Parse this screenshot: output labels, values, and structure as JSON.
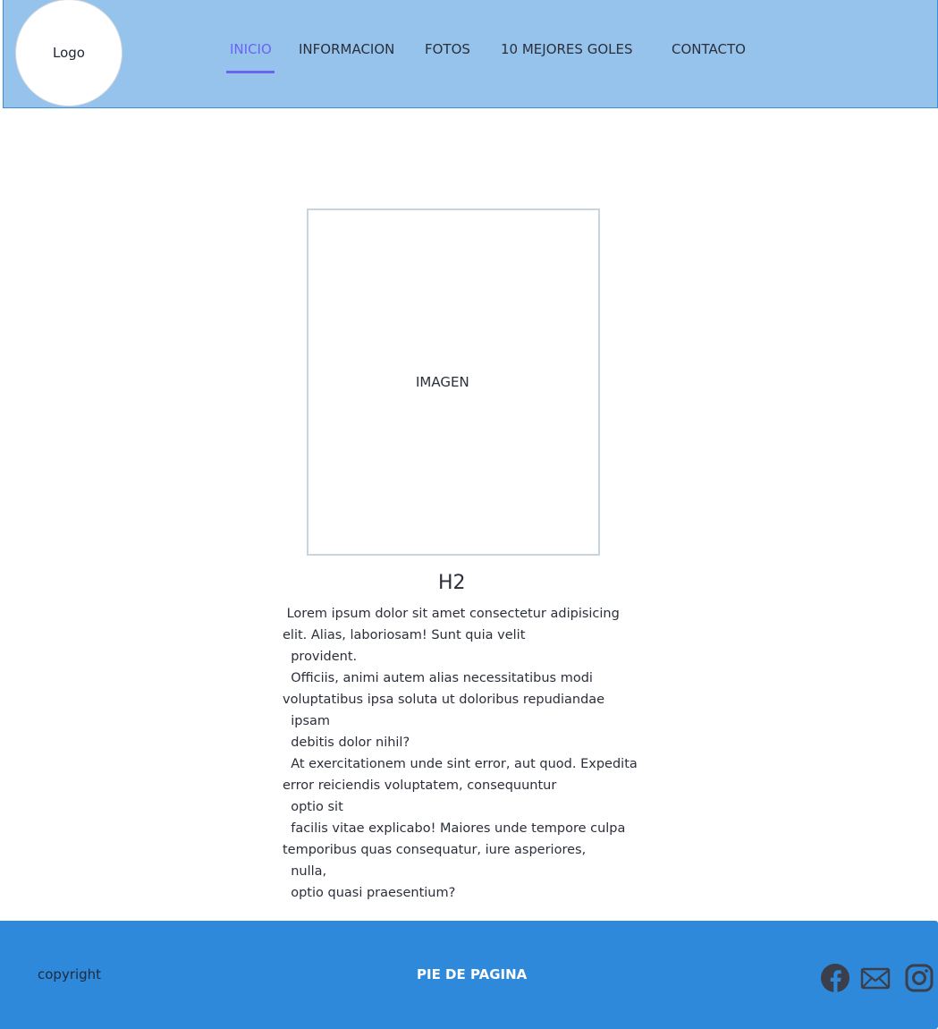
{
  "header": {
    "logo_label": "Logo",
    "nav": [
      {
        "label": "INICIO",
        "active": true
      },
      {
        "label": "INFORMACION",
        "active": false
      },
      {
        "label": "FOTOS",
        "active": false
      },
      {
        "label": "10 MEJORES GOLES",
        "active": false
      },
      {
        "label": "CONTACTO",
        "active": false
      }
    ]
  },
  "main": {
    "image_label": "IMAGEN",
    "heading": "H2",
    "paragraph_lines": [
      " Lorem ipsum dolor sit amet consectetur adipisicing",
      "elit. Alias, laboriosam! Sunt quia velit",
      "  provident.",
      "  Officiis, animi autem alias necessitatibus modi",
      "voluptatibus ipsa soluta ut doloribus repudiandae",
      "  ipsam",
      "  debitis dolor nihil?",
      "  At exercitationem unde sint error, aut quod. Expedita",
      "error reiciendis voluptatem, consequuntur",
      "  optio sit",
      "  facilis vitae explicabo! Maiores unde tempore culpa",
      "temporibus quas consequatur, iure asperiores,",
      "  nulla,",
      "  optio quasi praesentium?"
    ]
  },
  "footer": {
    "copyright": "copyright",
    "title": "PIE DE PAGINA",
    "social_icons": [
      "facebook-icon",
      "mail-icon",
      "instagram-icon"
    ]
  },
  "colors": {
    "header_bg": "#96c3ec",
    "nav_active": "#6b63f2",
    "footer_bg": "#2e89da",
    "icon": "#3a3f4b"
  }
}
